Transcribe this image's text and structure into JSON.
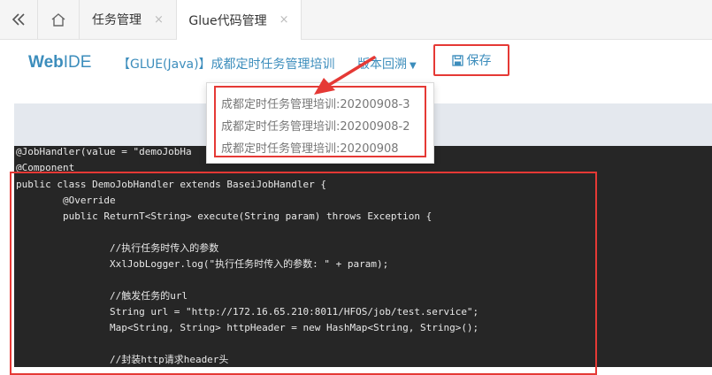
{
  "tabs": [
    {
      "label": "任务管理",
      "close": "×"
    },
    {
      "label": "Glue代码管理",
      "close": "×"
    }
  ],
  "header": {
    "logo_bold": "Web",
    "logo_rest": "IDE",
    "job_title": "【GLUE(Java)】成都定时任务管理培训",
    "version_label": "版本回溯",
    "save_label": "保存"
  },
  "versions": [
    "成都定时任务管理培训:20200908-3",
    "成都定时任务管理培训:20200908-2",
    "成都定时任务管理培训:20200908"
  ],
  "code": [
    "@JobHandler(value = \"demoJobHa",
    "@Component",
    "public class DemoJobHandler extends BaseiJobHandler {",
    "        @Override",
    "        public ReturnT<String> execute(String param) throws Exception {",
    "",
    "                //执行任务时传入的参数",
    "                XxlJobLogger.log(\"执行任务时传入的参数: \" + param);",
    "",
    "                //触发任务的url",
    "                String url = \"http://172.16.65.210:8011/HFOS/job/test.service\";",
    "                Map<String, String> httpHeader = new HashMap<String, String>();",
    "",
    "                //封装http请求header头"
  ],
  "colors": {
    "accent": "#3c8dbc",
    "highlight": "#e53935",
    "editor_bg": "#262626"
  }
}
